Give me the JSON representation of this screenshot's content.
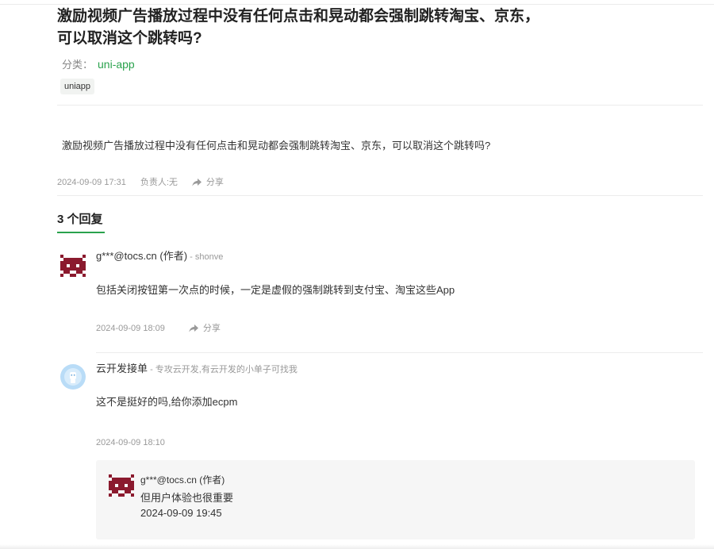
{
  "question": {
    "title_line1": "激励视频广告播放过程中没有任何点击和晃动都会强制跳转淘宝、京东，",
    "title_line2": "可以取消这个跳转吗?",
    "category_label": "分类：",
    "category_value": "uni-app",
    "tag": "uniapp",
    "body": "激励视频广告播放过程中没有任何点击和晃动都会强制跳转淘宝、京东，可以取消这个跳转吗?",
    "date": "2024-09-09 17:31",
    "owner": "负责人:无",
    "share_label": "分享"
  },
  "replies_title": "3 个回复",
  "replies": [
    {
      "author": "g***@tocs.cn (作者)",
      "sep": " - ",
      "sub": "shonve",
      "text": "包括关闭按钮第一次点的时候，一定是虚假的强制跳转到支付宝、淘宝这些App",
      "date": "2024-09-09 18:09",
      "share_label": "分享"
    },
    {
      "author": "云开发接单",
      "sep": " - ",
      "sub": "专攻云开发,有云开发的小单子可找我",
      "text": "这不是挺好的吗,给你添加ecpm",
      "date": "2024-09-09 18:10",
      "nested": {
        "author": "g***@tocs.cn (作者)",
        "text": "但用户体验也很重要",
        "date": "2024-09-09 19:45"
      }
    }
  ],
  "colors": {
    "accent": "#2aa24d",
    "avatar_red": "#8b1a2e",
    "avatar_blue": "#b9dcf7"
  }
}
